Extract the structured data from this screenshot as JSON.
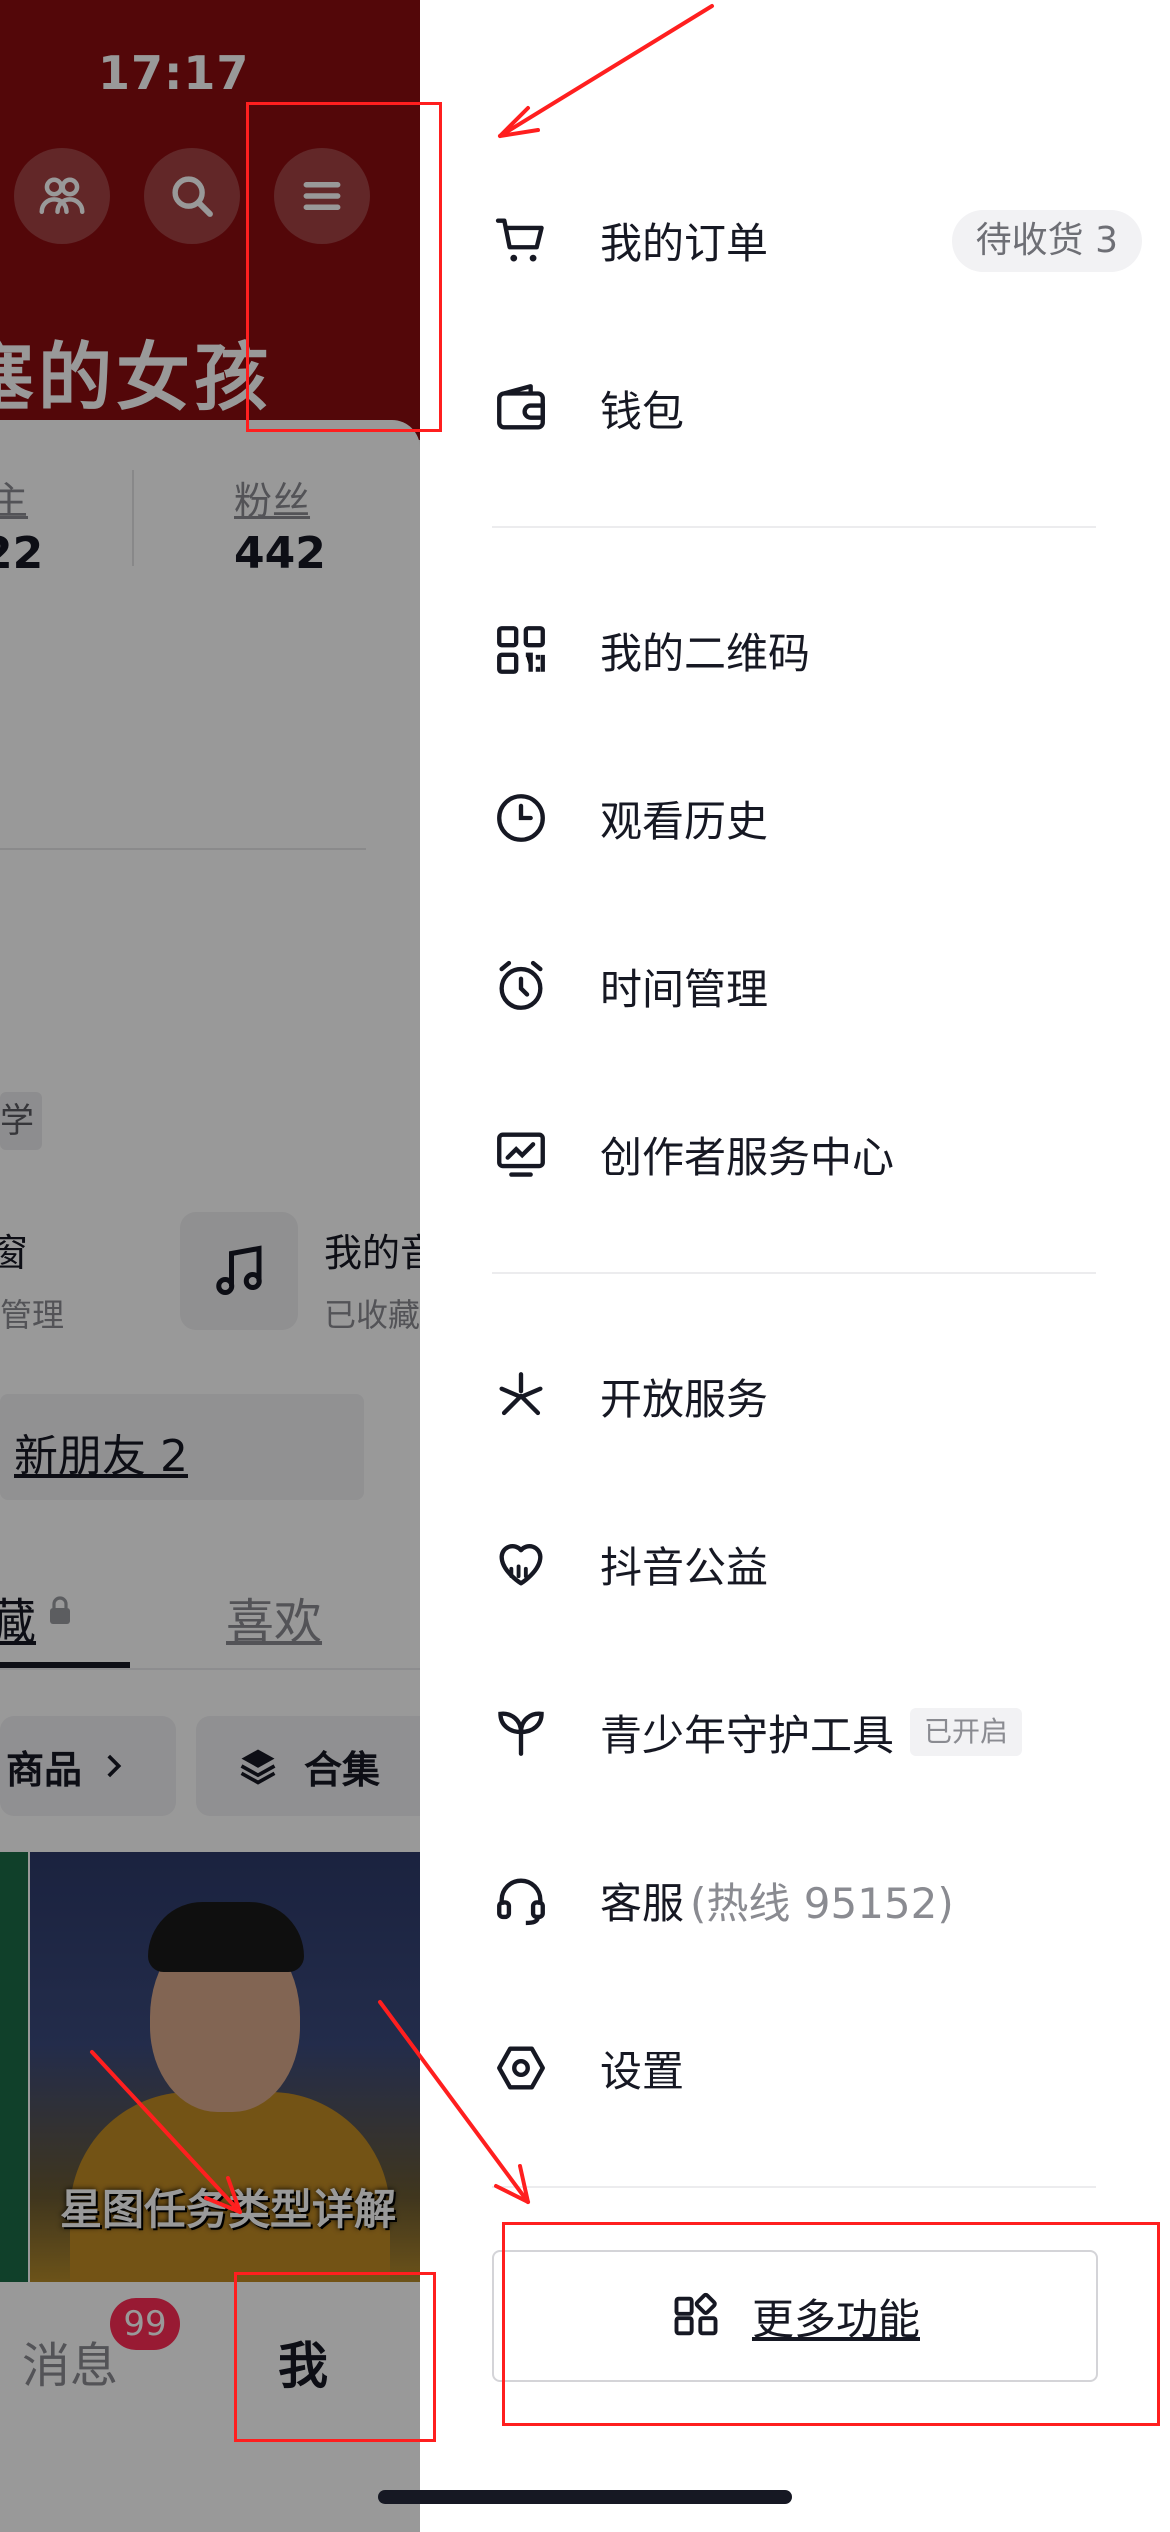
{
  "status_bar": {
    "time": "17:17"
  },
  "background_profile": {
    "name_partial": "塞的女孩",
    "stats": [
      {
        "label": "主",
        "value": "22"
      },
      {
        "label": "粉丝",
        "value": "442"
      }
    ],
    "tag_partial": "学",
    "shop_title_partial": "窗",
    "shop_sub_partial": "管理",
    "music_title_partial": "我的音",
    "music_sub_partial": "已收藏",
    "new_friends": "新朋友 2",
    "tabs": {
      "collect_partial": "藏",
      "like": "喜欢"
    },
    "chips": [
      {
        "label": "商品"
      },
      {
        "label": "合集"
      }
    ],
    "video_caption": "星图任务类型详解",
    "nav": {
      "messages": "消息",
      "messages_badge": "99",
      "me": "我"
    }
  },
  "drawer": {
    "items": [
      {
        "icon": "cart-icon",
        "label": "我的订单",
        "badge": "待收货 3"
      },
      {
        "icon": "wallet-icon",
        "label": "钱包"
      },
      {
        "icon": "qrcode-icon",
        "label": "我的二维码"
      },
      {
        "icon": "clock-icon",
        "label": "观看历史"
      },
      {
        "icon": "alarm-icon",
        "label": "时间管理"
      },
      {
        "icon": "creator-chart-icon",
        "label": "创作者服务中心"
      },
      {
        "icon": "open-service-icon",
        "label": "开放服务"
      },
      {
        "icon": "charity-heart-icon",
        "label": "抖音公益"
      },
      {
        "icon": "sprout-icon",
        "label": "青少年守护工具",
        "tag": "已开启"
      },
      {
        "icon": "headset-icon",
        "label": "客服",
        "extra": "(热线 95152)"
      },
      {
        "icon": "settings-hexagon-icon",
        "label": "设置"
      }
    ],
    "more_button": {
      "icon": "grid-apps-icon",
      "label": "更多功能"
    }
  }
}
